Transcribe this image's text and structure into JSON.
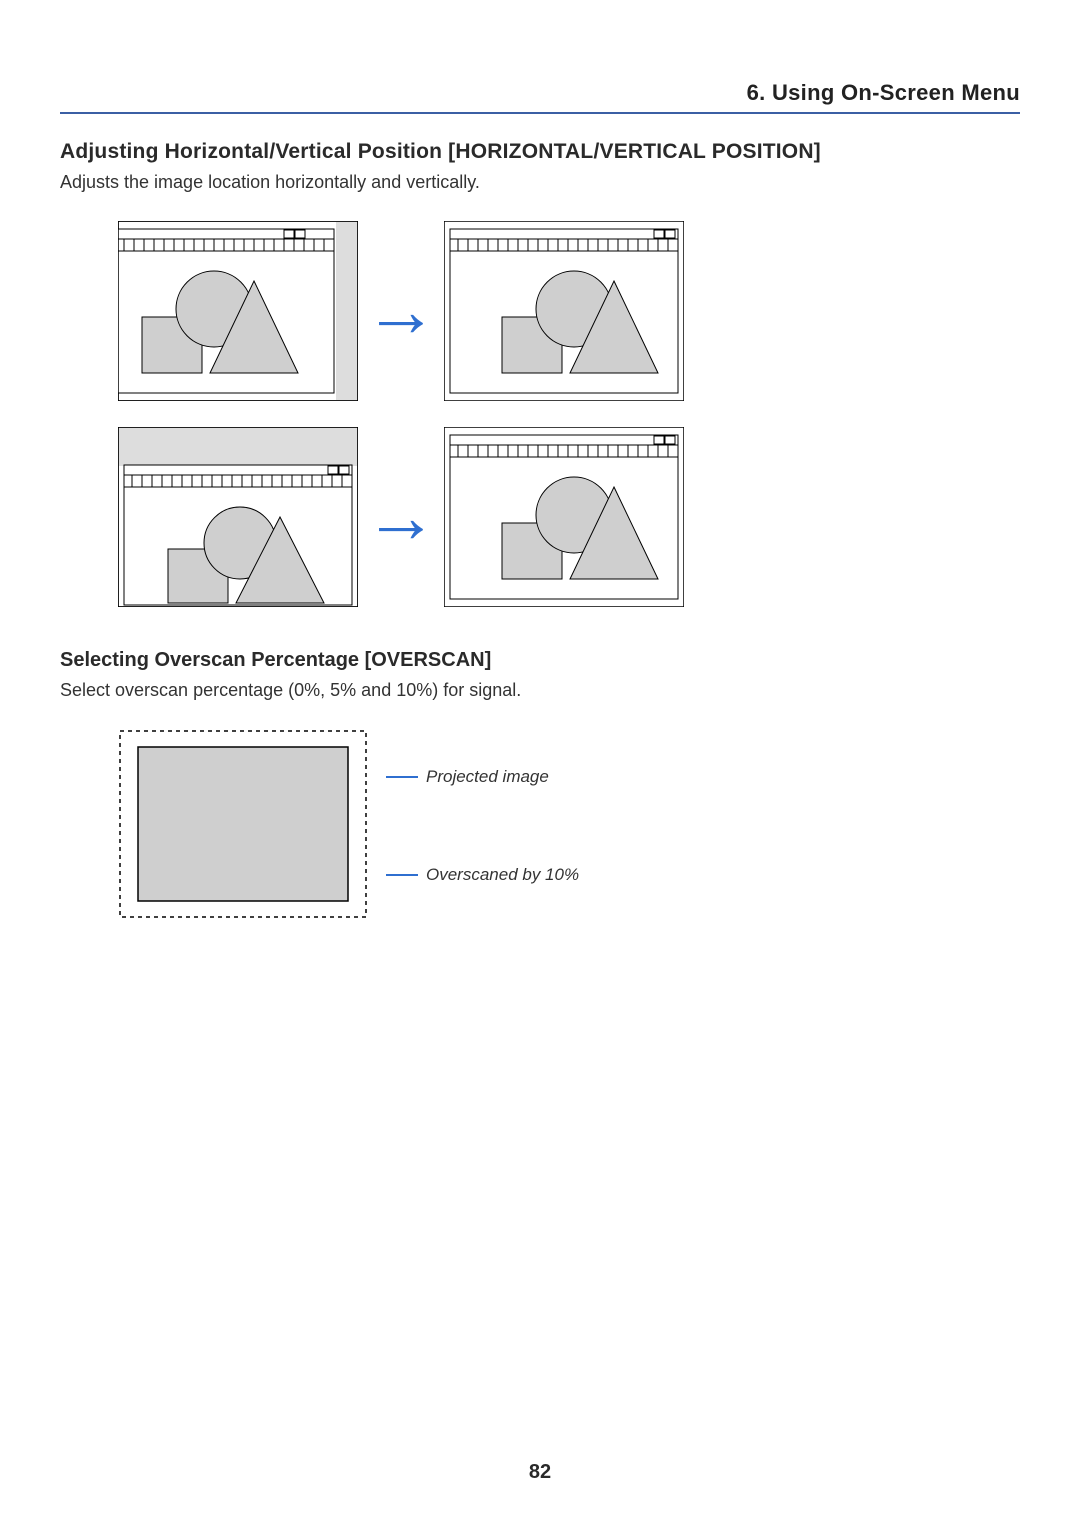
{
  "header": "6. Using On-Screen Menu",
  "section1": {
    "title": "Adjusting Horizontal/Vertical Position [HORIZONTAL/VERTICAL POSITION]",
    "body": "Adjusts the image location horizontally and vertically."
  },
  "section2": {
    "title": "Selecting Overscan Percentage [OVERSCAN]",
    "body": "Select overscan percentage (0%, 5% and 10%) for signal."
  },
  "overscan": {
    "label_projected": "Projected image",
    "label_overscan": "Overscaned by 10%"
  },
  "page_number": "82"
}
